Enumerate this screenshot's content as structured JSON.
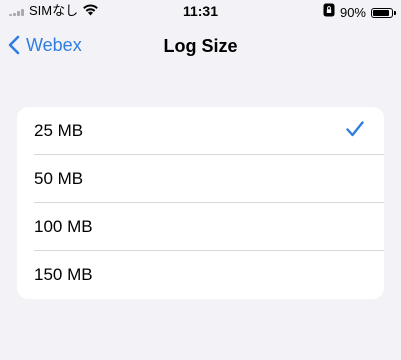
{
  "status_bar": {
    "carrier": "SIMなし",
    "time": "11:31",
    "battery_percent": "90%",
    "battery_level": 0.9
  },
  "nav": {
    "back_label": "Webex",
    "title": "Log Size"
  },
  "options": [
    {
      "label": "25 MB",
      "selected": true
    },
    {
      "label": "50 MB",
      "selected": false
    },
    {
      "label": "100 MB",
      "selected": false
    },
    {
      "label": "150 MB",
      "selected": false
    }
  ],
  "colors": {
    "accent": "#2f7ee0",
    "background": "#f2f2f7"
  }
}
